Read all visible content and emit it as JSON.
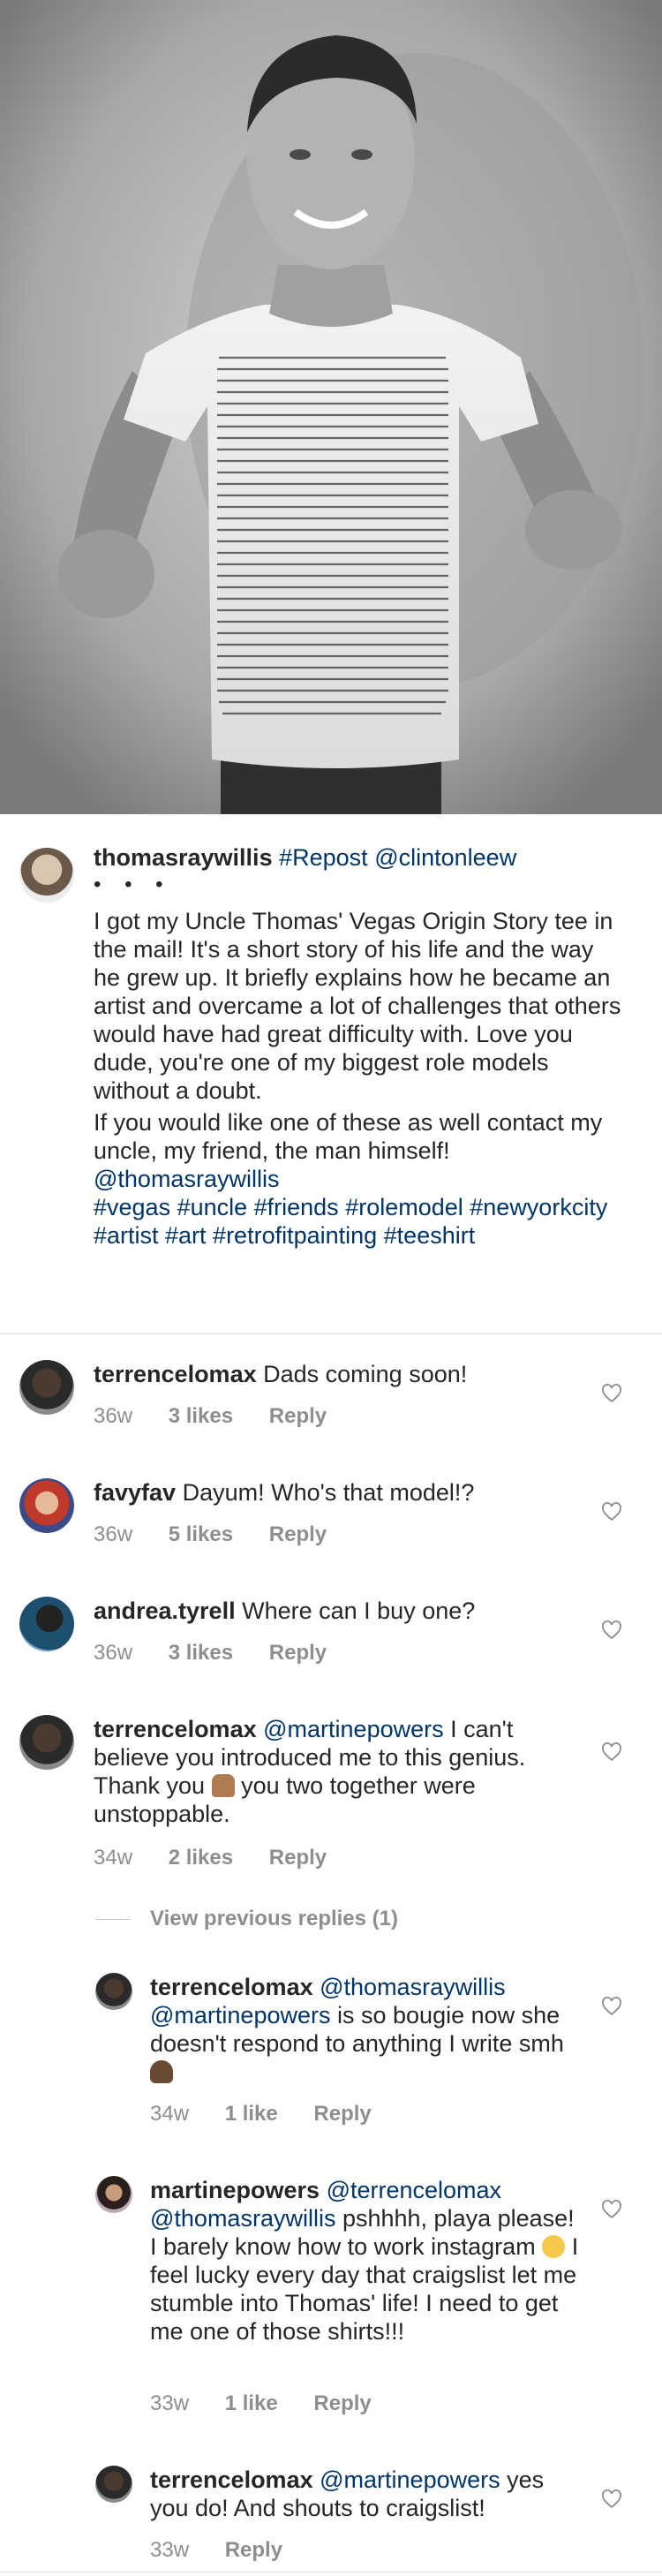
{
  "post": {
    "author": "thomasraywillis",
    "caption_tags": [
      "#Repost",
      "@clintonleew"
    ],
    "more_dots": "• • •",
    "caption_paragraph_1": "I got my Uncle Thomas' Vegas Origin Story tee in the mail! It's a short story of his life and the way he grew up. It briefly explains how he became an artist and overcame a lot of challenges that others would have had great difficulty with. Love you dude, you're one of my biggest role models without a doubt.",
    "caption_paragraph_2": "If you would like one of these as well contact my uncle, my friend, the man himself!",
    "caption_mention": "@thomasraywillis",
    "hashtags": "#vegas #uncle #friends #rolemodel #newyorkcity #artist #art #retrofitpainting #teeshirt"
  },
  "comments": [
    {
      "user": "terrencelomax",
      "text": "Dads coming soon!",
      "time": "36w",
      "likes": "3 likes",
      "reply": "Reply"
    },
    {
      "user": "favyfav",
      "text": "Dayum! Who's that model!?",
      "time": "36w",
      "likes": "5 likes",
      "reply": "Reply"
    },
    {
      "user": "andrea.tyrell",
      "text": "Where can I buy one?",
      "time": "36w",
      "likes": "3 likes",
      "reply": "Reply"
    },
    {
      "user": "terrencelomax",
      "mention": "@martinepowers",
      "text_a": "I can't believe you introduced me to this genius. Thank you",
      "text_b": "you two together were unstoppable.",
      "time": "34w",
      "likes": "2 likes",
      "reply": "Reply"
    }
  ],
  "view_previous": "View previous replies (1)",
  "replies": [
    {
      "user": "terrencelomax",
      "mention_1": "@thomasraywillis",
      "mention_2": "@martinepowers",
      "text": "is so bougie now she doesn't respond to anything I write smh",
      "time": "34w",
      "likes": "1 like",
      "reply": "Reply"
    },
    {
      "user": "martinepowers",
      "mention_1": "@terrencelomax",
      "mention_2": "@thomasraywillis",
      "text_a": "pshhhh, playa please! I barely know how to work instagram",
      "text_b": "I feel lucky every day that craigslist let me stumble into Thomas' life! I need to get me one of those shirts!!!",
      "time": "33w",
      "likes": "1 like",
      "reply": "Reply"
    },
    {
      "user": "terrencelomax",
      "mention": "@martinepowers",
      "text": "yes you do! And shouts to craigslist!",
      "time": "33w",
      "reply": "Reply"
    }
  ],
  "colors": {
    "link": "#003569",
    "meta": "#8e8e8e",
    "text": "#262626"
  },
  "icons": [
    "heart-icon"
  ]
}
